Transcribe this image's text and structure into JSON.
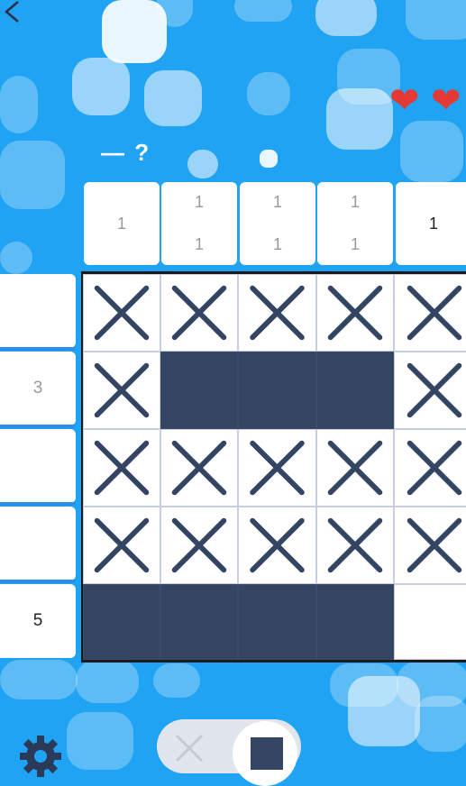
{
  "header": {
    "back_icon": "chevron-left-icon",
    "hint_label": "— ?",
    "lives": 2
  },
  "column_clues": [
    [
      "1"
    ],
    [
      "1",
      "1"
    ],
    [
      "1",
      "1"
    ],
    [
      "1",
      "1"
    ],
    [
      "1"
    ]
  ],
  "column_done": [
    false,
    false,
    false,
    false,
    true
  ],
  "row_clues": [
    "",
    "3",
    "",
    "",
    "5"
  ],
  "row_done": [
    false,
    false,
    false,
    false,
    true
  ],
  "board": [
    [
      "x",
      "x",
      "x",
      "x",
      "x"
    ],
    [
      "x",
      "f",
      "f",
      "f",
      "x"
    ],
    [
      "x",
      "x",
      "x",
      "x",
      "x"
    ],
    [
      "x",
      "x",
      "x",
      "x",
      "x"
    ],
    [
      "f",
      "f",
      "f",
      "f",
      ""
    ]
  ],
  "controls": {
    "settings_icon": "gear-icon",
    "mode_cross_icon": "cross-icon",
    "mode_fill_icon": "filled-square-icon",
    "active_mode": "fill"
  },
  "colors": {
    "background": "#1fa3f2",
    "filled": "#344563",
    "heart": "#e53935",
    "mark": "#344563"
  }
}
